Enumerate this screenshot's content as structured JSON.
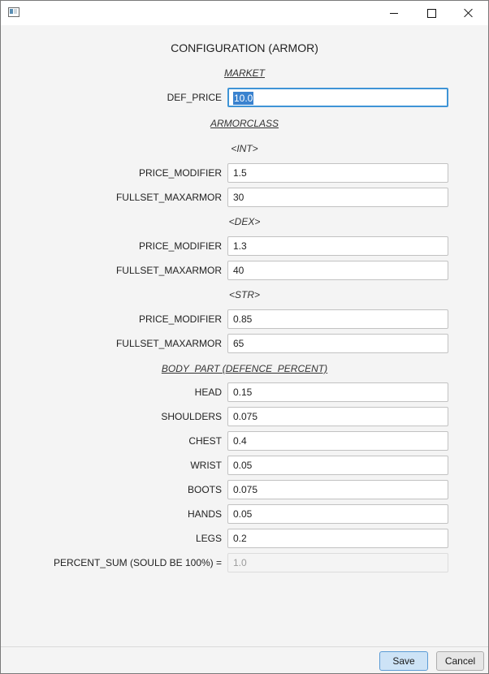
{
  "window": {
    "title": ""
  },
  "heading": "CONFIGURATION (ARMOR)",
  "market": {
    "section_title": "MARKET",
    "def_price_label": "DEF_PRICE",
    "def_price_value": "10.0"
  },
  "armorclass": {
    "section_title": "ARMORCLASS",
    "int": {
      "title": "<INT>",
      "price_modifier_label": "PRICE_MODIFIER",
      "price_modifier_value": "1.5",
      "fullset_maxarmor_label": "FULLSET_MAXARMOR",
      "fullset_maxarmor_value": "30"
    },
    "dex": {
      "title": "<DEX>",
      "price_modifier_label": "PRICE_MODIFIER",
      "price_modifier_value": "1.3",
      "fullset_maxarmor_label": "FULLSET_MAXARMOR",
      "fullset_maxarmor_value": "40"
    },
    "str": {
      "title": "<STR>",
      "price_modifier_label": "PRICE_MODIFIER",
      "price_modifier_value": "0.85",
      "fullset_maxarmor_label": "FULLSET_MAXARMOR",
      "fullset_maxarmor_value": "65"
    }
  },
  "body_part": {
    "section_title": "BODY_PART (DEFENCE_PERCENT)",
    "head": {
      "label": "HEAD",
      "value": "0.15"
    },
    "shoulders": {
      "label": "SHOULDERS",
      "value": "0.075"
    },
    "chest": {
      "label": "CHEST",
      "value": "0.4"
    },
    "wrist": {
      "label": "WRIST",
      "value": "0.05"
    },
    "boots": {
      "label": "BOOTS",
      "value": "0.075"
    },
    "hands": {
      "label": "HANDS",
      "value": "0.05"
    },
    "legs": {
      "label": "LEGS",
      "value": "0.2"
    },
    "percent_sum": {
      "label": "PERCENT_SUM (SOULD BE 100%) =",
      "value": "1.0"
    }
  },
  "footer": {
    "save_label": "Save",
    "cancel_label": "Cancel"
  },
  "colors": {
    "accent": "#3f94d6",
    "selection": "#3a82cf",
    "save_bg": "#cde3f6"
  }
}
